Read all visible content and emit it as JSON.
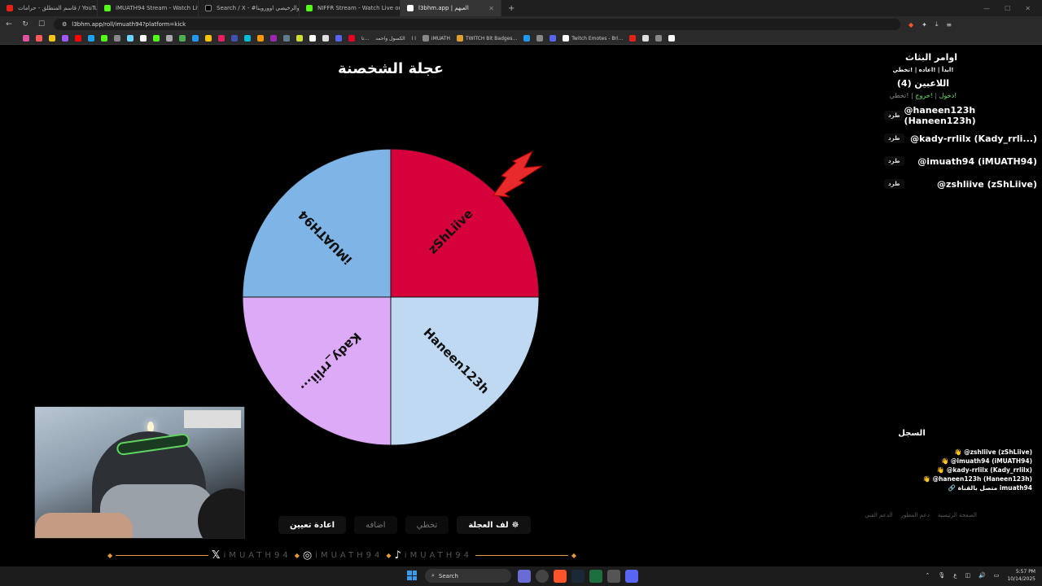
{
  "browser": {
    "tabs": [
      {
        "label": "قاسم المنطلق - حرامات / YouTube -",
        "color": "#e62117"
      },
      {
        "label": "iMUATH94 Stream - Watch Live on K",
        "color": "#53fc18"
      },
      {
        "label": "Search / X - #ضحالتي والرخيصي اووروينا",
        "color": "#000000"
      },
      {
        "label": "NIFFR Stream - Watch Live on Kick",
        "color": "#53fc18"
      },
      {
        "label": "l3bhm.app | العبهم",
        "color": "#ffffff",
        "active": true
      }
    ],
    "url": "l3bhm.app/roll/imuath94?platform=kick",
    "bookmarks": [
      "تا...",
      "الكسول واحمد",
      "ا ا",
      "iMUATH",
      "TWITCH Bit Badges...",
      "Twitch Emotes - Bri..."
    ]
  },
  "wheel": {
    "title": "عجلة الشخصنة",
    "segments": [
      {
        "label": "zShLiive",
        "color": "#d6003a"
      },
      {
        "label": "Haneen123h",
        "color": "#bfd9f2"
      },
      {
        "label": "Kady_rrlii...",
        "color": "#dcaaf7"
      },
      {
        "label": "iMUATH94",
        "color": "#7eb4e6"
      }
    ]
  },
  "controls": {
    "spin": "لف العجلة",
    "spin_icon": "☸",
    "skip": "تخطي",
    "add": "اضافه",
    "reset": "اعادة تعيين"
  },
  "social": {
    "x_handle": "iMUATH94",
    "ig_handle": "iMUATH94",
    "tt_handle": "iMUATH94"
  },
  "panel": {
    "streamer_cmds_title": "اوامر البثاث",
    "streamer_cmds": "!ابدأ | !اعاده | !تخطي",
    "players_title": "اللاعبين (4)",
    "join": "!دخول",
    "leave": "!خروج",
    "skip": "!تخطي",
    "kick_label": "طرد",
    "players": [
      "@haneen123h (Haneen123h)",
      "@kady-rrlilx (Kady_rrli...)",
      "@imuath94 (iMUATH94)",
      "@zshliive (zShLiive)"
    ],
    "log_title": "السجل",
    "log": [
      "👋 @zshliive (zShLiive)",
      "👋 @imuath94 (iMUATH94)",
      "👋 @kady-rrlilx (Kady_rrlilx)",
      "👋 @haneen123h (Haneen123h)",
      "🔗 متصل بالقناة imuath94"
    ]
  },
  "footer": {
    "home": "الصفحة الرئيسية",
    "support_dev": "دعم المطور",
    "tech_support": "الدعم الفني"
  },
  "taskbar": {
    "search": "Search",
    "time": "5:57 PM",
    "date": "10/14/2025"
  }
}
